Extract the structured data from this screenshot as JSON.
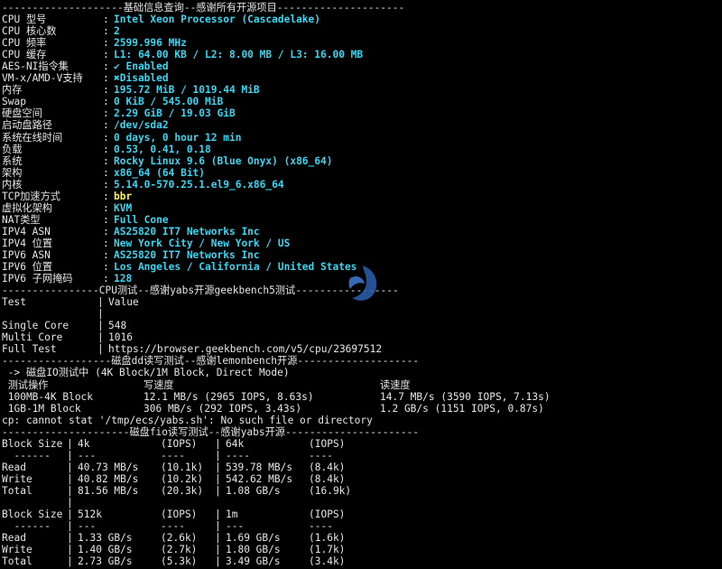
{
  "separators": {
    "basic": "--------------------基础信息查询--感谢所有开源项目---------------------",
    "cpu": "----------------CPU测试--感谢yabs开源geekbench5测试-----------------",
    "disk_dd": "------------------磁盘dd读写测试--感谢lemonbench开源--------------------",
    "disk_fio": "---------------------磁盘fio读写测试--感谢yabs开源----------------------"
  },
  "basic_info": [
    {
      "key": "CPU 型号",
      "value": "Intel Xeon Processor (Cascadelake)"
    },
    {
      "key": "CPU 核心数",
      "value": "2"
    },
    {
      "key": "CPU 频率",
      "value": "2599.996 MHz"
    },
    {
      "key": "CPU 缓存",
      "value": "L1: 64.00 KB / L2: 8.00 MB / L3: 16.00 MB"
    },
    {
      "key": "AES-NI指令集",
      "value": "✔ Enabled"
    },
    {
      "key": "VM-x/AMD-V支持",
      "value": "✖Disabled"
    },
    {
      "key": "内存",
      "value": "195.72 MiB / 1019.44 MiB"
    },
    {
      "key": "Swap",
      "value": "0 KiB / 545.00 MiB"
    },
    {
      "key": "硬盘空间",
      "value": "2.29 GiB / 19.03 GiB"
    },
    {
      "key": "启动盘路径",
      "value": "/dev/sda2"
    },
    {
      "key": "系统在线时间",
      "value": "0 days, 0 hour 12 min"
    },
    {
      "key": "负载",
      "value": "0.53, 0.41, 0.18"
    },
    {
      "key": "系统",
      "value": "Rocky Linux 9.6 (Blue Onyx) (x86_64)"
    },
    {
      "key": "架构",
      "value": "x86_64 (64 Bit)"
    },
    {
      "key": "内核",
      "value": "5.14.0-570.25.1.el9_6.x86_64"
    },
    {
      "key": "TCP加速方式",
      "value": "bbr"
    },
    {
      "key": "虚拟化架构",
      "value": "KVM"
    },
    {
      "key": "NAT类型",
      "value": "Full Cone"
    },
    {
      "key": "IPV4 ASN",
      "value": "AS25820 IT7 Networks Inc"
    },
    {
      "key": "IPV4 位置",
      "value": "New York City / New York / US"
    },
    {
      "key": "IPV6 ASN",
      "value": "AS25820 IT7 Networks Inc"
    },
    {
      "key": "IPV6 位置",
      "value": "Los Angeles / California / United States"
    },
    {
      "key": "IPV6 子网掩码",
      "value": "128"
    }
  ],
  "cpu_table": {
    "header": [
      "Test",
      "Value"
    ],
    "rows": [
      [
        "Single Core",
        "548"
      ],
      [
        "Multi Core",
        "1016"
      ],
      [
        "Full Test",
        "https://browser.geekbench.com/v5/cpu/23697512"
      ]
    ]
  },
  "dd": {
    "intro": " -> 磁盘IO测试中 (4K Block/1M Block, Direct Mode)",
    "header": [
      " 测试操作",
      "写速度",
      "读速度"
    ],
    "rows": [
      [
        " 100MB-4K Block",
        "12.1 MB/s (2965 IOPS, 8.63s)",
        "14.7 MB/s (3590 IOPS, 7.13s)"
      ],
      [
        " 1GB-1M Block",
        "306 MB/s (292 IOPS, 3.43s)",
        "1.2 GB/s (1151 IOPS, 0.87s)"
      ]
    ],
    "error": "cp: cannot stat '/tmp/ecs/yabs.sh': No such file or directory"
  },
  "fio": {
    "block1": {
      "header": [
        "Block Size",
        "4k",
        "(IOPS)",
        "64k",
        "(IOPS)"
      ],
      "dashes": [
        "  ------",
        "---",
        "----",
        "----",
        "----"
      ],
      "rows": [
        [
          "Read",
          "40.73 MB/s",
          "(10.1k)",
          "539.78 MB/s",
          "(8.4k)"
        ],
        [
          "Write",
          "40.82 MB/s",
          "(10.2k)",
          "542.62 MB/s",
          "(8.4k)"
        ],
        [
          "Total",
          "81.56 MB/s",
          "(20.3k)",
          "1.08 GB/s",
          "(16.9k)"
        ]
      ]
    },
    "block2": {
      "header": [
        "Block Size",
        "512k",
        "(IOPS)",
        "1m",
        "(IOPS)"
      ],
      "dashes": [
        "  ------",
        "---",
        "----",
        "---",
        "----"
      ],
      "rows": [
        [
          "Read",
          "1.33 GB/s",
          "(2.6k)",
          "1.69 GB/s",
          "(1.6k)"
        ],
        [
          "Write",
          "1.40 GB/s",
          "(2.7k)",
          "1.80 GB/s",
          "(1.7k)"
        ],
        [
          "Total",
          "2.73 GB/s",
          "(5.3k)",
          "3.49 GB/s",
          "(3.4k)"
        ]
      ]
    }
  },
  "colors": {
    "value": "#35d7f2",
    "highlight": "#fff44f",
    "text": "#e6e6e6",
    "bg": "#000000"
  }
}
